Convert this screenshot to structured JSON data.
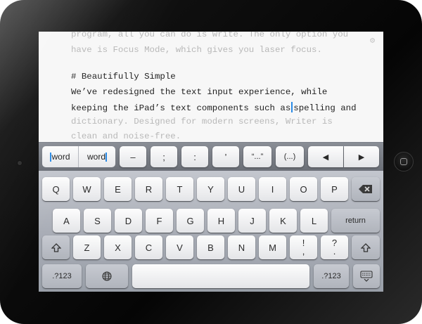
{
  "editor": {
    "lines": [
      {
        "text": "program, all you can do is write. The only option you",
        "style": "faded"
      },
      {
        "text": "have is Focus Mode, which gives you laser focus.",
        "style": "faded"
      },
      {
        "text": "",
        "style": "normal"
      },
      {
        "text": "# Beautifully Simple",
        "style": "normal"
      },
      {
        "text": "We’ve redesigned the text input experience, while",
        "style": "normal"
      },
      {
        "text": "keeping the iPad’s text components such as",
        "style": "normal"
      },
      {
        "text": "dictionary. Designed for modern screens, Writer is",
        "style": "faded"
      },
      {
        "text": "clean and noise-free.",
        "style": "faded"
      }
    ],
    "caret_line_rest": "spelling and",
    "gear_icon": "gear-icon"
  },
  "extension_row": {
    "word_left": "word",
    "word_right": "word",
    "keys": [
      "–",
      ";",
      ":",
      "’",
      "“...”",
      "(...)",
      "◀",
      "▶"
    ]
  },
  "keyboard": {
    "row1": [
      "Q",
      "W",
      "E",
      "R",
      "T",
      "Y",
      "U",
      "I",
      "O",
      "P"
    ],
    "row2": [
      "A",
      "S",
      "D",
      "F",
      "G",
      "H",
      "J",
      "K",
      "L"
    ],
    "row3": [
      "Z",
      "X",
      "C",
      "V",
      "B",
      "N",
      "M"
    ],
    "punct1": {
      "top": "!",
      "bottom": ","
    },
    "punct2": {
      "top": "?",
      "bottom": "."
    },
    "return_label": "return",
    "numbers_label": ".?123",
    "backspace_icon": "backspace-icon",
    "shift_icon": "shift-icon",
    "globe_icon": "globe-icon",
    "hide_keyboard_icon": "hide-keyboard-icon"
  }
}
